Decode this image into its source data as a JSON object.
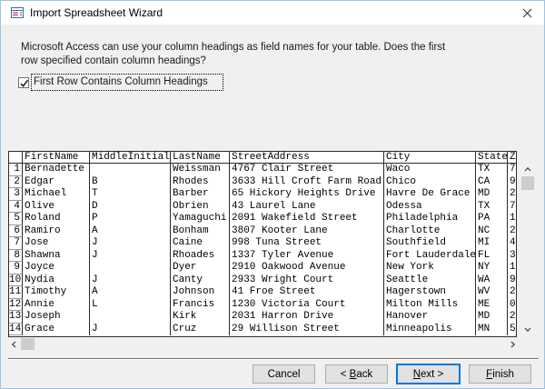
{
  "window": {
    "title": "Import Spreadsheet Wizard"
  },
  "intro": {
    "line1": "Microsoft Access can use your column headings as field names for your table. Does the first",
    "line2": "row specified contain column headings?"
  },
  "options": {
    "first_row_label": "First Row Contains Column Headings",
    "first_row_checked": true
  },
  "grid": {
    "corner": "",
    "columns": [
      "FirstName",
      "MiddleInitial",
      "LastName",
      "StreetAddress",
      "City",
      "State",
      "Z"
    ],
    "rows": [
      {
        "num": "1",
        "cells": [
          "Bernadette",
          "",
          "Weissman",
          "4767 Clair Street",
          "Waco",
          "TX",
          "7"
        ]
      },
      {
        "num": "2",
        "cells": [
          "Edgar",
          "B",
          "Rhodes",
          "3633 Hill Croft Farm Road",
          "Chico",
          "CA",
          "9"
        ]
      },
      {
        "num": "3",
        "cells": [
          "Michael",
          "T",
          "Barber",
          "65 Hickory Heights Drive",
          "Havre De Grace",
          "MD",
          "2"
        ]
      },
      {
        "num": "4",
        "cells": [
          "Olive",
          "D",
          "Obrien",
          "43 Laurel Lane",
          "Odessa",
          "TX",
          "7"
        ]
      },
      {
        "num": "5",
        "cells": [
          "Roland",
          "P",
          "Yamaguchi",
          "2091 Wakefield Street",
          "Philadelphia",
          "PA",
          "1"
        ]
      },
      {
        "num": "6",
        "cells": [
          "Ramiro",
          "A",
          "Bonham",
          "3807 Kooter Lane",
          "Charlotte",
          "NC",
          "2"
        ]
      },
      {
        "num": "7",
        "cells": [
          "Jose",
          "J",
          "Caine",
          "998 Tuna Street",
          "Southfield",
          "MI",
          "4"
        ]
      },
      {
        "num": "8",
        "cells": [
          "Shawna",
          "J",
          "Rhoades",
          "1337 Tyler Avenue",
          "Fort Lauderdale",
          "FL",
          "3"
        ]
      },
      {
        "num": "9",
        "cells": [
          "Joyce",
          "",
          "Dyer",
          "2910 Oakwood Avenue",
          "New York",
          "NY",
          "1"
        ]
      },
      {
        "num": "10",
        "cells": [
          "Nydia",
          "J",
          "Canty",
          "2933 Wright Court",
          "Seattle",
          "WA",
          "9"
        ]
      },
      {
        "num": "11",
        "cells": [
          "Timothy",
          "A",
          "Johnson",
          "41 Froe Street",
          "Hagerstown",
          "WV",
          "2"
        ]
      },
      {
        "num": "12",
        "cells": [
          "Annie",
          "L",
          "Francis",
          "1230 Victoria Court",
          "Milton Mills",
          "ME",
          "0"
        ]
      },
      {
        "num": "13",
        "cells": [
          "Joseph",
          "",
          "Kirk",
          "2031 Harron Drive",
          "Hanover",
          "MD",
          "2"
        ]
      },
      {
        "num": "14",
        "cells": [
          "Grace",
          "J",
          "Cruz",
          "29 Willison Street",
          "Minneapolis",
          "MN",
          "5"
        ]
      }
    ]
  },
  "buttons": {
    "cancel": "Cancel",
    "back": {
      "pre": "< ",
      "key": "B",
      "post": "ack"
    },
    "next": {
      "pre": "",
      "key": "N",
      "post": "ext >"
    },
    "finish": {
      "pre": "",
      "key": "F",
      "post": "inish"
    }
  },
  "colors": {
    "accent_focus": "#0078d7",
    "window_border": "#9cc3e5"
  }
}
